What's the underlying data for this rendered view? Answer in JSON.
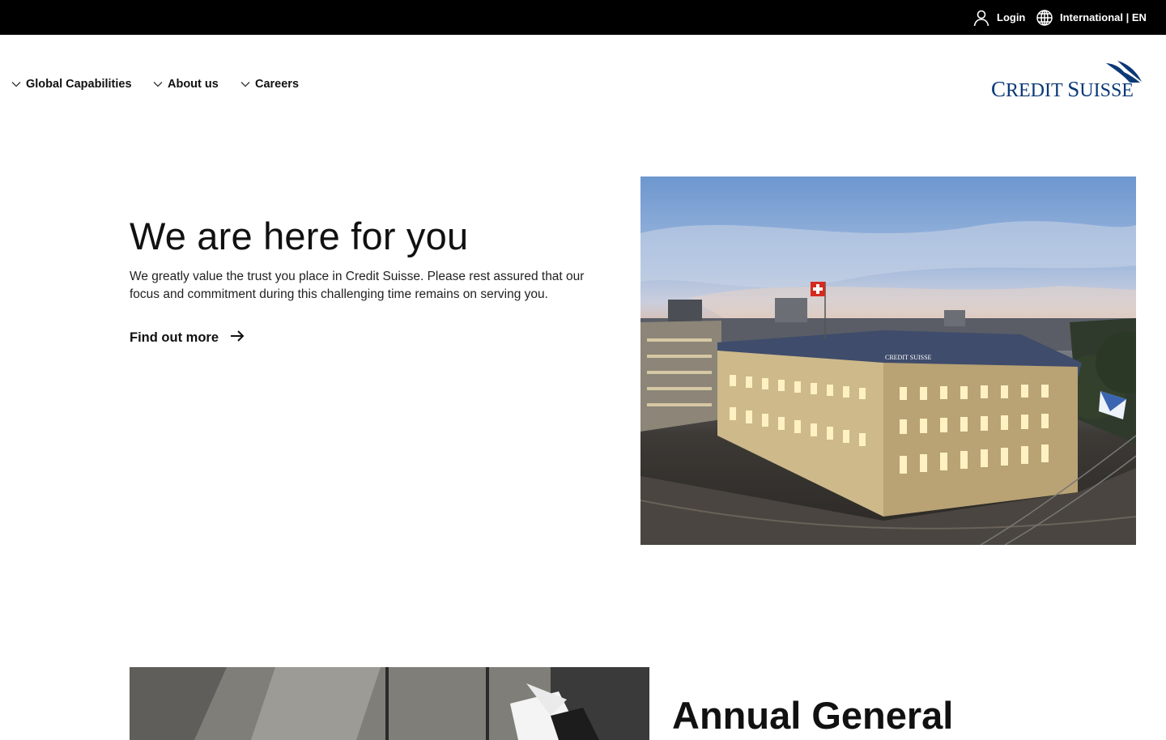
{
  "topbar": {
    "login_label": "Login",
    "login_icon": "user-icon",
    "locale_label": "International | EN",
    "locale_icon": "globe-icon"
  },
  "nav": {
    "items": [
      {
        "label": "Global Capabilities",
        "icon": "chevron-down-icon"
      },
      {
        "label": "About us",
        "icon": "chevron-down-icon"
      },
      {
        "label": "Careers",
        "icon": "chevron-down-icon"
      }
    ]
  },
  "brand": {
    "logo_text_c": "C",
    "logo_text_1": "REDIT ",
    "logo_text_s": "S",
    "logo_text_2": "UISSE",
    "color": "#0a3877"
  },
  "hero": {
    "title": "We are here for you",
    "text": "We greatly value the trust you place in Credit Suisse. Please rest assured that our focus and commitment during this challenging time remains on serving you.",
    "cta_label": "Find out more",
    "cta_icon": "arrow-right-icon",
    "image_sign": "CREDIT SUISSE"
  },
  "agm": {
    "title": "Annual General"
  },
  "colors": {
    "topbar_bg": "#000000",
    "brand_blue": "#0a3877",
    "text": "#111111"
  }
}
